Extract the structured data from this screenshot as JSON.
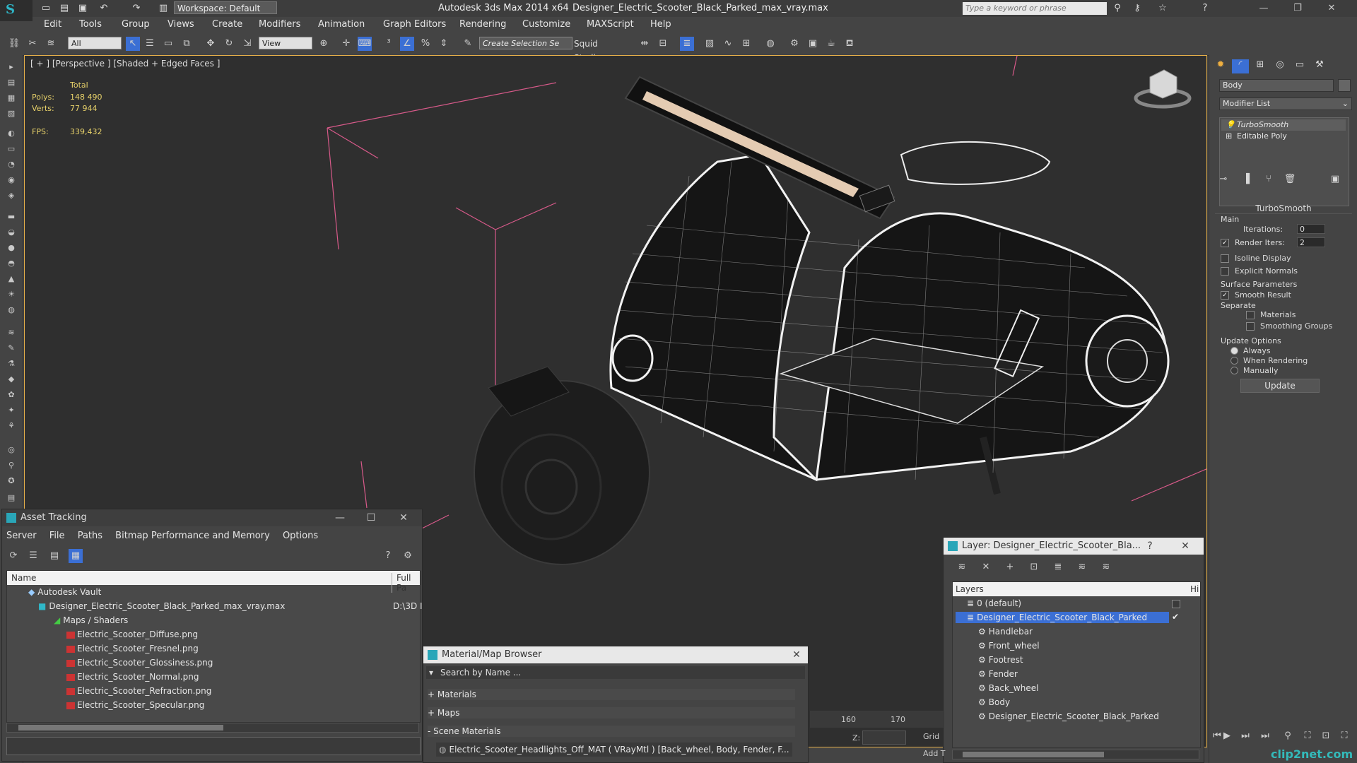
{
  "titlebar": {
    "workspace": "Workspace: Default",
    "app_title": "Autodesk 3ds Max  2014 x64",
    "file_title": "Designer_Electric_Scooter_Black_Parked_max_vray.max",
    "search_placeholder": "Type a keyword or phrase"
  },
  "menubar": [
    "Edit",
    "Tools",
    "Group",
    "Views",
    "Create",
    "Modifiers",
    "Animation",
    "Graph Editors",
    "Rendering",
    "Customize",
    "MAXScript",
    "Help"
  ],
  "toolbar": {
    "filter_select": "All",
    "refcoord_select": "View",
    "selection_set": "Create Selection Se",
    "studio": "Squid Studio v"
  },
  "viewport": {
    "label": "[ + ] [Perspective ] [Shaded + Edged Faces ]",
    "stats_total": "Total",
    "polys_label": "Polys:",
    "polys_value": "148 490",
    "verts_label": "Verts:",
    "verts_value": "77 944",
    "fps_label": "FPS:",
    "fps_value": "339,432"
  },
  "command_panel": {
    "object_name": "Body",
    "modifier_list": "Modifier List",
    "stack": [
      "TurboSmooth",
      "Editable Poly"
    ],
    "rollout_title": "TurboSmooth",
    "main_label": "Main",
    "iterations_label": "Iterations:",
    "iterations_value": "0",
    "render_iters_label": "Render Iters:",
    "render_iters_value": "2",
    "isoline_label": "Isoline Display",
    "explicit_normals_label": "Explicit Normals",
    "surface_params_label": "Surface Parameters",
    "smooth_result_label": "Smooth Result",
    "separate_label": "Separate",
    "materials_label": "Materials",
    "smoothing_groups_label": "Smoothing Groups",
    "update_options_label": "Update Options",
    "always_label": "Always",
    "when_rendering_label": "When Rendering",
    "manually_label": "Manually",
    "update_button": "Update"
  },
  "asset_tracking": {
    "title": "Asset Tracking",
    "menus": [
      "Server",
      "File",
      "Paths",
      "Bitmap Performance and Memory",
      "Options"
    ],
    "col_name": "Name",
    "col_path": "Full Pa",
    "vault": "Autodesk Vault",
    "max_file": "Designer_Electric_Scooter_Black_Parked_max_vray.max",
    "max_path": "D:\\3D I",
    "maps_folder": "Maps / Shaders",
    "maps": [
      "Electric_Scooter_Diffuse.png",
      "Electric_Scooter_Fresnel.png",
      "Electric_Scooter_Glossiness.png",
      "Electric_Scooter_Normal.png",
      "Electric_Scooter_Refraction.png",
      "Electric_Scooter_Specular.png"
    ]
  },
  "material_browser": {
    "title": "Material/Map Browser",
    "search_placeholder": "Search by Name ...",
    "groups": [
      "+ Materials",
      "+ Maps",
      "- Scene Materials"
    ],
    "scene_material": "Electric_Scooter_Headlights_Off_MAT ( VRayMtl ) [Back_wheel, Body, Fender, F..."
  },
  "layer_dialog": {
    "title": "Layer: Designer_Electric_Scooter_Bla...",
    "help": "?",
    "col_layers": "Layers",
    "col_hide": "Hi",
    "layers": [
      "0 (default)",
      "Designer_Electric_Scooter_Black_Parked"
    ],
    "children": [
      "Handlebar",
      "Front_wheel",
      "Footrest",
      "Fender",
      "Back_wheel",
      "Body",
      "Designer_Electric_Scooter_Black_Parked"
    ]
  },
  "timeline": {
    "ticks": [
      "160",
      "170"
    ],
    "z_label": "Z:",
    "grid_label": "Grid",
    "add_label": "Add T"
  },
  "watermark": "clip2net.com",
  "colors": {
    "accent_selection": "#3b6fd4",
    "viewport_border": "#e6b04a",
    "stats_text": "#e8d26a"
  }
}
